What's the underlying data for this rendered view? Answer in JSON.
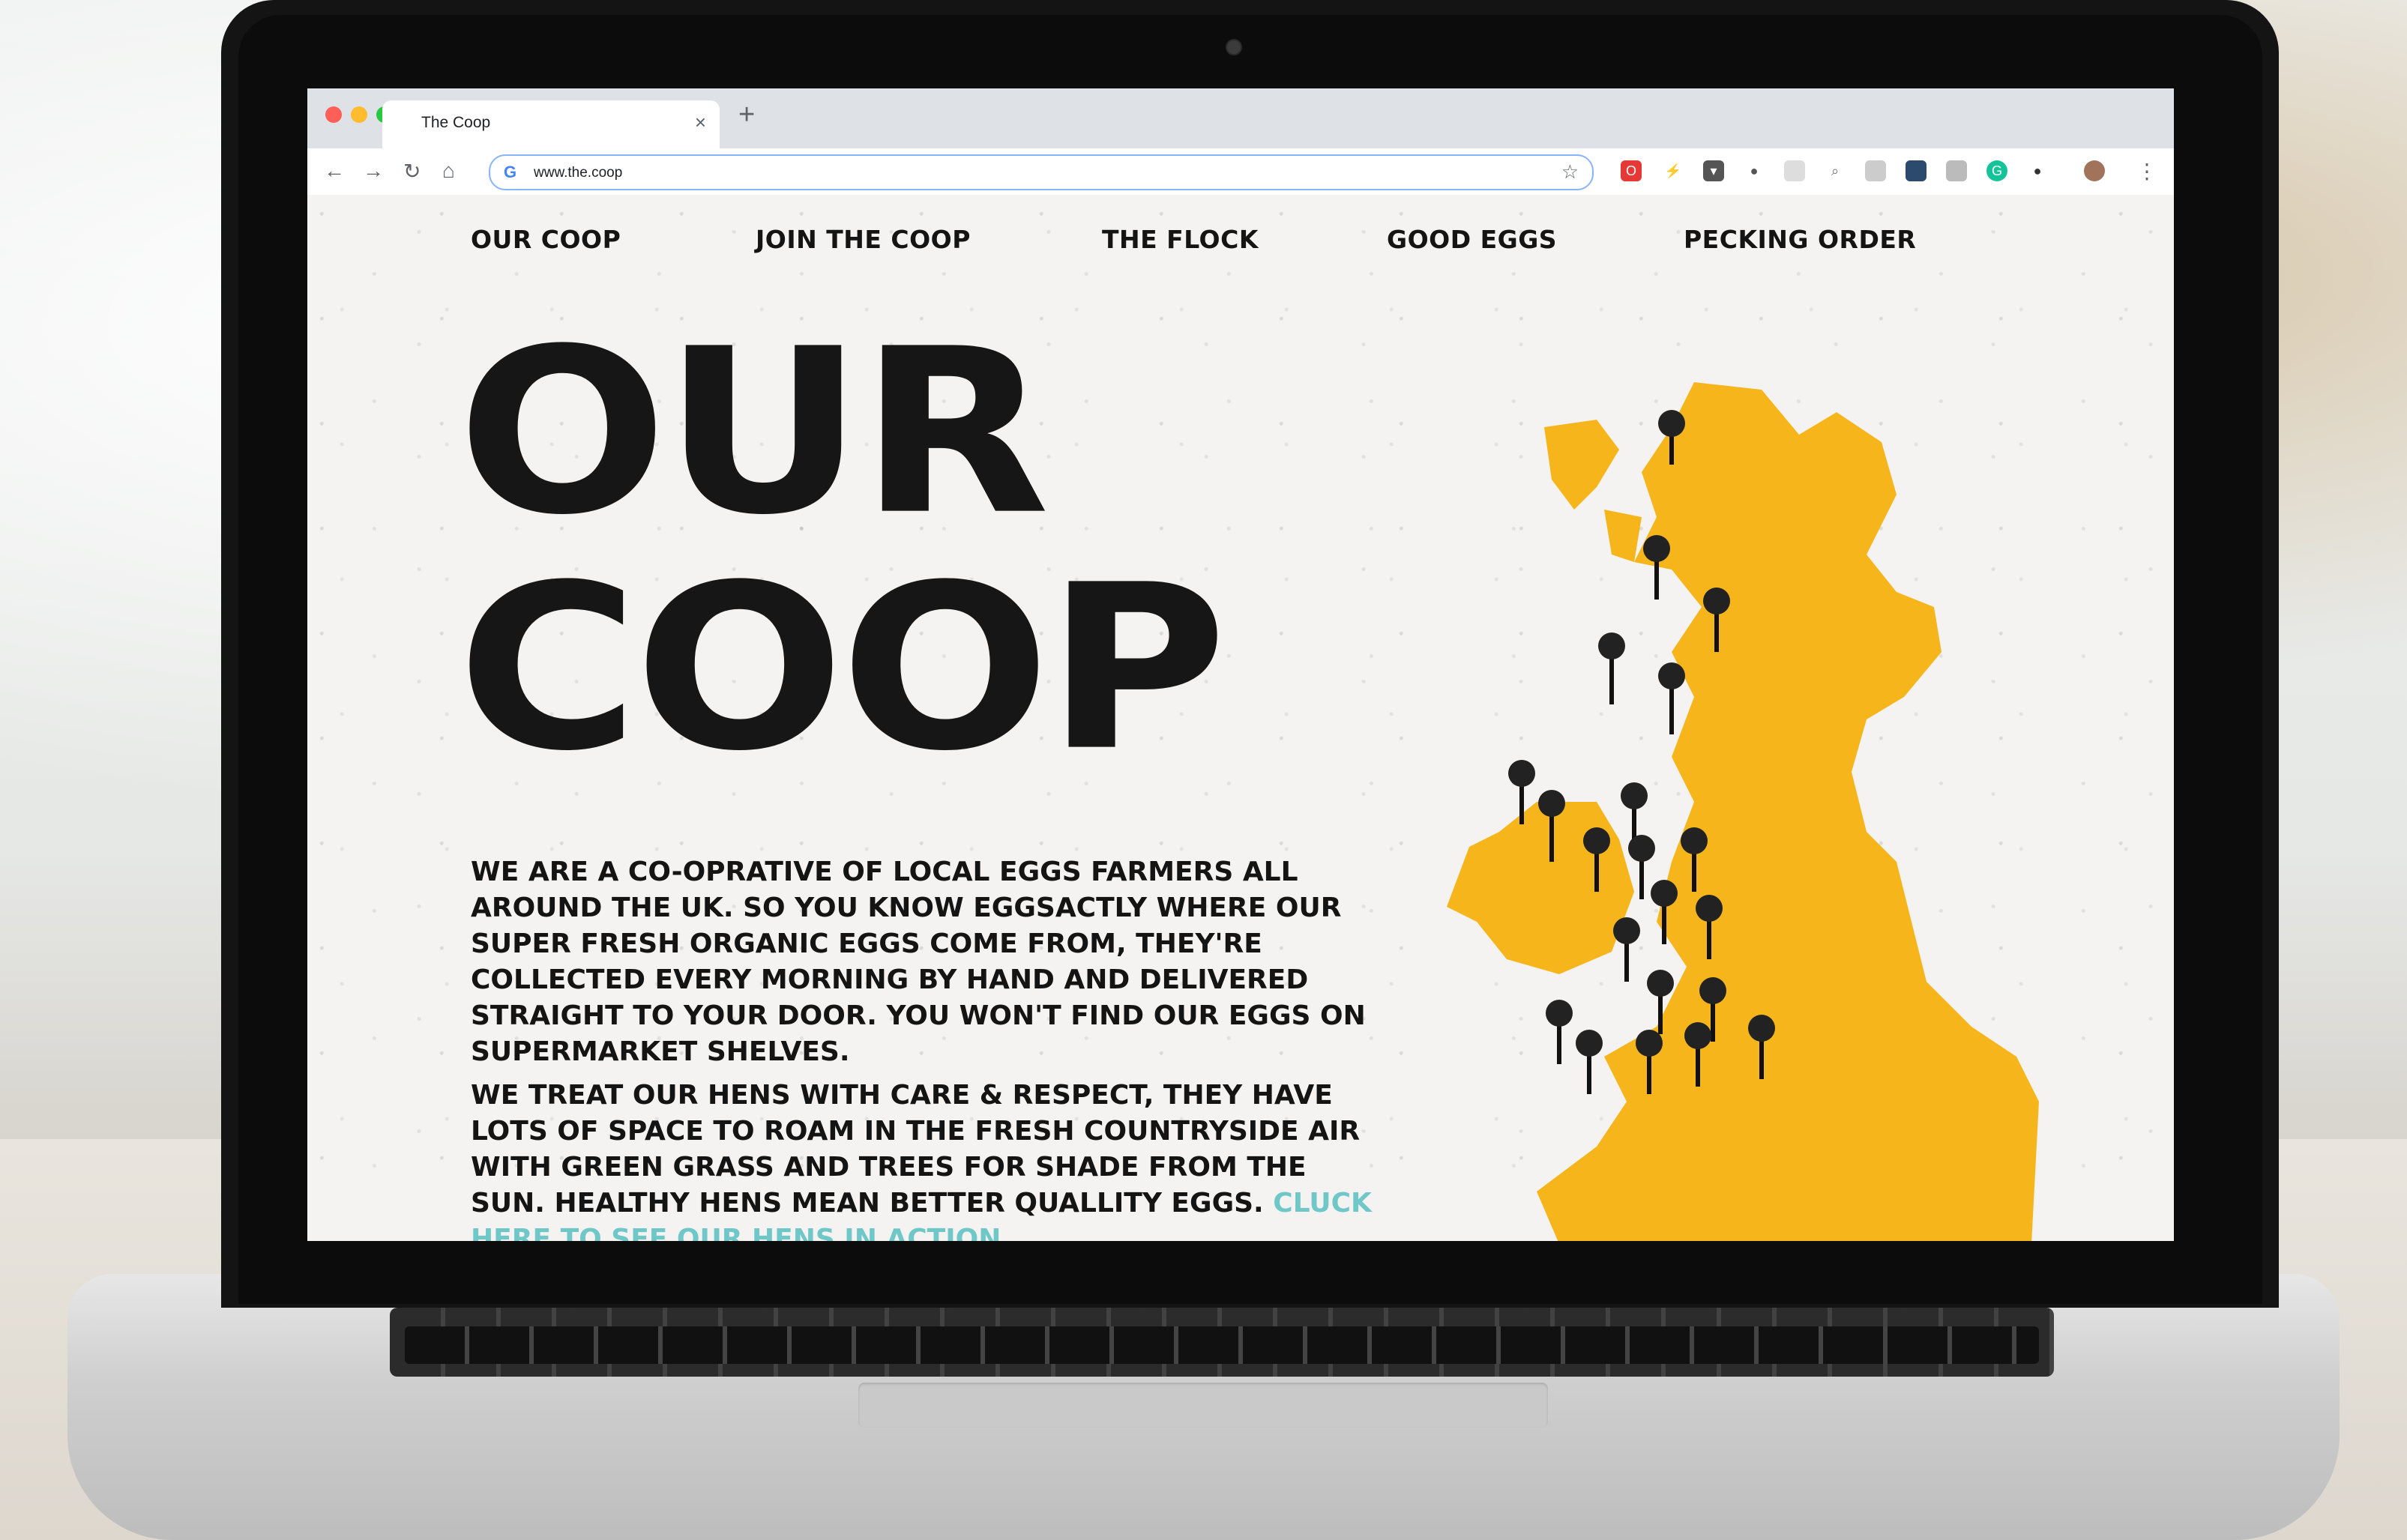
{
  "browser": {
    "tab_title": "The Coop",
    "url": "www.the.coop",
    "close_glyph": "×",
    "newtab_glyph": "+"
  },
  "nav": {
    "items": [
      {
        "label": "OUR COOP"
      },
      {
        "label": "JOIN THE COOP"
      },
      {
        "label": "THE FLOCK"
      },
      {
        "label": "GOOD EGGS"
      },
      {
        "label": "PECKING ORDER"
      }
    ]
  },
  "hero": {
    "line1": "OUR",
    "line2": "COOP"
  },
  "content": {
    "paragraph1": "We are a co-oprative of local eggs farmers all around the UK. So you know eggsactly where our super fresh organic eggs come from, they're collected every morning by hand and delivered straight to your door. You won't find our eggs on supermarket shelves.",
    "paragraph2": "We treat our hens with care & respect, they have lots of space to roam in the fresh countryside air with green grass and trees for shade from the sun. Healthy hens mean better quallity eggs.",
    "link_text": "Cluck here to see our hens in action."
  },
  "colors": {
    "accent_link": "#6fc7c8",
    "map_yellow": "#f6b51a",
    "text": "#141414"
  },
  "icons": [
    "back-icon",
    "forward-icon",
    "reload-icon",
    "home-icon",
    "star-icon",
    "menu-icon",
    "map-pin-icon"
  ]
}
